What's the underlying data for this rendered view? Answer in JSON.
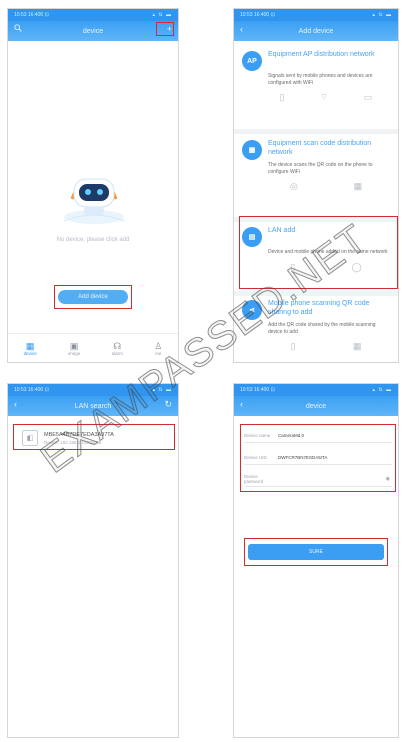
{
  "status_bar": {
    "time": "10:53 16:400 ⊡",
    "icons": "▴ ⇅ ▬"
  },
  "panel1": {
    "title": "device",
    "search_icon": "search-icon",
    "add_icon": "+",
    "empty_text": "No device, please click add",
    "add_button": "Add device",
    "tabs": [
      {
        "label": "device",
        "icon": "▦"
      },
      {
        "label": "image",
        "icon": "▣"
      },
      {
        "label": "alarm",
        "icon": "☊"
      },
      {
        "label": "me",
        "icon": "♙"
      }
    ]
  },
  "panel2": {
    "title": "Add device",
    "back_icon": "‹",
    "options": [
      {
        "badge": "AP",
        "title": "Equipment AP distribution network",
        "desc": "Signals sent by mobile phones and devices are configured with WiFi"
      },
      {
        "badge": "▦",
        "title": "Equipment scan code distribution network",
        "desc": "The device scans the QR code on the phone to configure WiFi"
      },
      {
        "badge": "▤",
        "title": "LAN add",
        "desc": "Device and mobile phone added on the same network"
      },
      {
        "badge": "⋖",
        "title": "Mobile phone scanning QR code sharing to add",
        "desc": "Add the QR code shared by the mobile scanning device to add"
      }
    ]
  },
  "panel3": {
    "title": "LAN search",
    "back_icon": "‹",
    "refresh_icon": "↻",
    "devices": [
      {
        "name": "MBE5A4B7DE7EDA3A97TA",
        "sub": "Device: 192.168.1.113:23:06"
      }
    ]
  },
  "panel4": {
    "title": "device",
    "back_icon": "‹",
    "fields": [
      {
        "label": "Device name",
        "value": "CameraMd.0"
      },
      {
        "label": "Device UID",
        "value": "DWFCR7BN7ESDA5ITA"
      },
      {
        "label": "Device password",
        "value": ""
      }
    ],
    "submit": "SURE"
  },
  "watermark": "EXAMPASSED.NET"
}
